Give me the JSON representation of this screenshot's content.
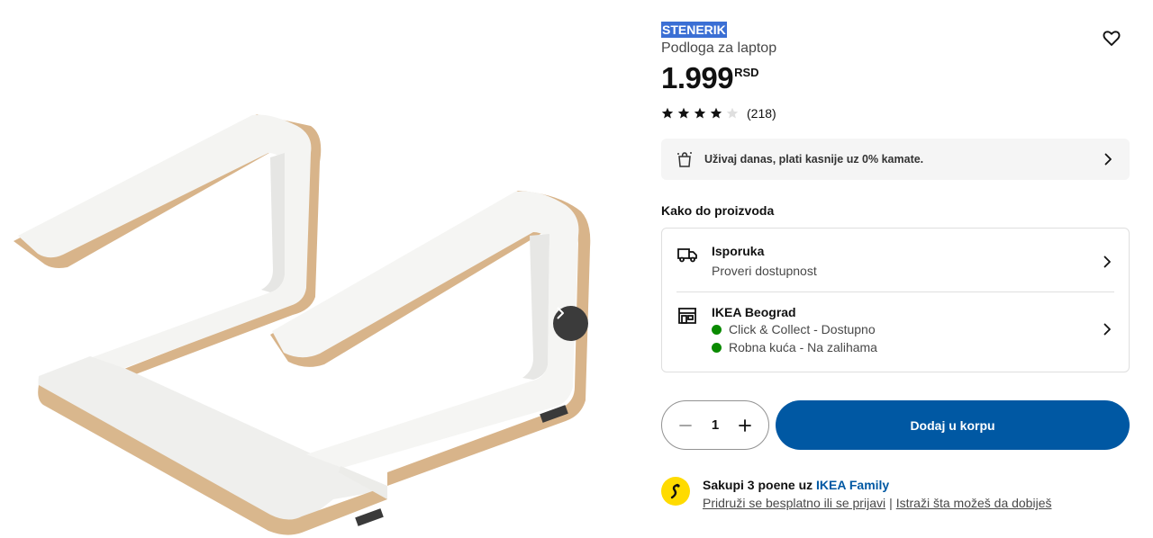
{
  "product": {
    "brand": "STENERIK",
    "subtitle": "Podloga za laptop",
    "price": "1.999",
    "currency": "RSD",
    "rating_value": 4,
    "rating_max": 5,
    "review_count": "(218)"
  },
  "pay_banner": {
    "text": "Uživaj danas, plati kasnije uz 0% kamate."
  },
  "availability": {
    "title": "Kako do proizvoda",
    "delivery": {
      "title": "Isporuka",
      "subtitle": "Proveri dostupnost"
    },
    "store": {
      "title": "IKEA Beograd",
      "status_1": "Click & Collect - Dostupno",
      "status_2": "Robna kuća - Na zalihama"
    }
  },
  "purchase": {
    "quantity": "1",
    "add_to_cart": "Dodaj u korpu"
  },
  "family": {
    "text_prefix": "Sakupi 3 poene uz",
    "link": "IKEA Family",
    "join_link": "Pridruži se besplatno ili se prijavi",
    "separator": "|",
    "explore_link": "Istraži šta možeš da dobiješ"
  },
  "colors": {
    "primary_blue": "#0058a3",
    "available_green": "#0a8a00",
    "family_yellow": "#ffdb00"
  },
  "icons": {
    "favorite": "heart-icon",
    "next": "chevron-right-icon",
    "delivery": "truck-icon",
    "store": "store-icon",
    "pay": "shopping-bag-icon",
    "family": "ikea-family-icon"
  }
}
